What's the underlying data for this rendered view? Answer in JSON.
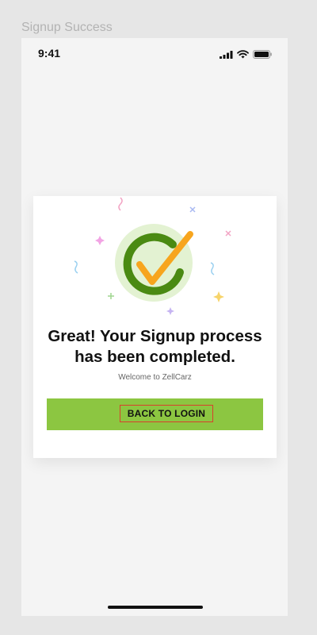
{
  "frame": {
    "title": "Signup Success"
  },
  "status_bar": {
    "time": "9:41",
    "icons": [
      "signal-icon",
      "wifi-icon",
      "battery-icon"
    ]
  },
  "success_card": {
    "icon": "check-circle-icon",
    "headline_line1": "Great! Your Signup process",
    "headline_line2": "has been completed.",
    "subtext": "Welcome to ZellCarz",
    "button_label": "BACK TO LOGIN"
  },
  "colors": {
    "accent_green": "#8cc641",
    "check_orange": "#f7a51e",
    "ring_green": "#4a8a12",
    "ring_bg": "#e3f2d2",
    "highlight_red": "#d8402b"
  }
}
